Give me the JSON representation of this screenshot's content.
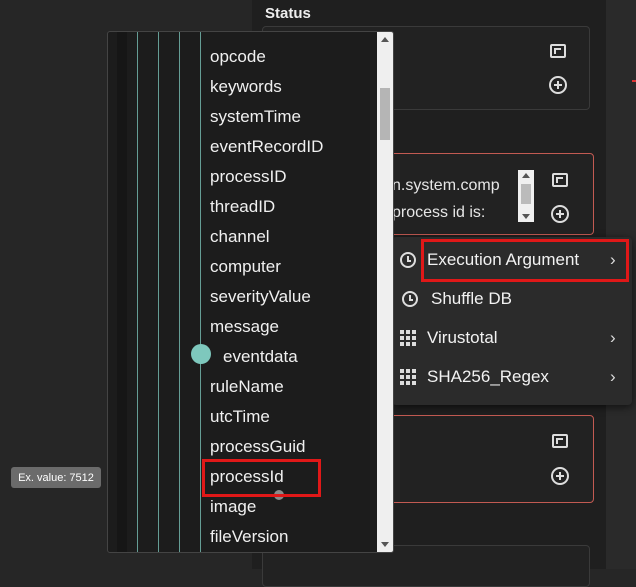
{
  "status_panel": {
    "title": "Status"
  },
  "argument_snippet": {
    "line1": "n.system.comp",
    "line2": "process id is:"
  },
  "context_menu": {
    "items": [
      {
        "label": "Execution Argument",
        "icon": "clock-icon",
        "has_submenu": true,
        "highlighted": true
      },
      {
        "label": "Shuffle DB",
        "icon": "clock-icon",
        "has_submenu": false
      },
      {
        "label": "Virustotal",
        "icon": "grid-icon",
        "has_submenu": true
      },
      {
        "label": "SHA256_Regex",
        "icon": "grid-icon",
        "has_submenu": true
      }
    ],
    "chevron": "›"
  },
  "field_dropdown": {
    "items": [
      "opcode",
      "keywords",
      "systemTime",
      "eventRecordID",
      "processID",
      "threadID",
      "channel",
      "computer",
      "severityValue",
      "message",
      "eventdata",
      "ruleName",
      "utcTime",
      "processGuid",
      "processId",
      "image",
      "fileVersion"
    ],
    "highlighted_item": "processId"
  },
  "tooltip": {
    "text": "Ex. value: 7512"
  },
  "colors": {
    "highlight": "#e01818",
    "tree_line": "#7ec8bd",
    "card_border_active": "#c25a52"
  }
}
